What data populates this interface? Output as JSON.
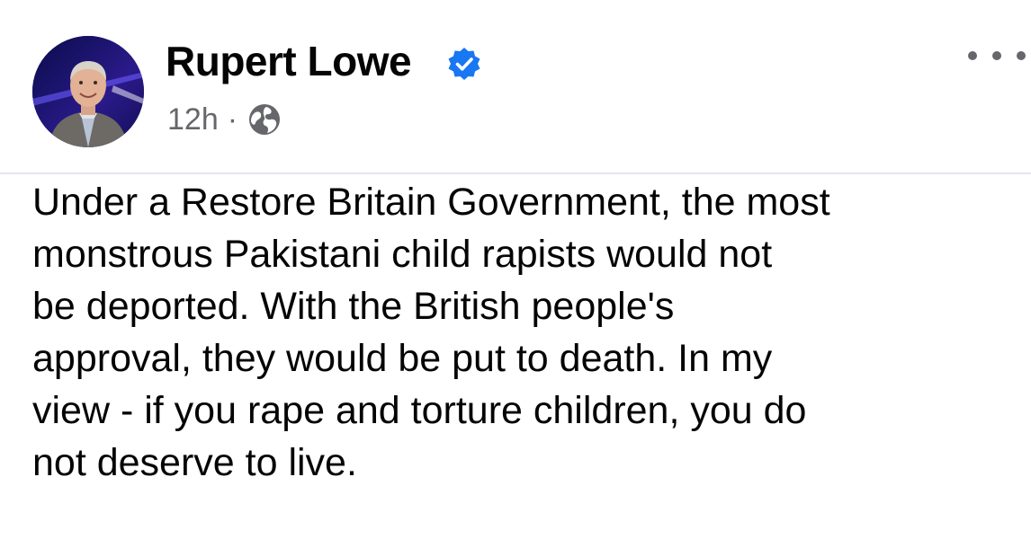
{
  "post": {
    "author": "Rupert Lowe",
    "timestamp": "12h",
    "separator": "·",
    "privacy_icon": "globe-icon",
    "verified_icon": "verified-badge-icon",
    "more_icon": "more-options-icon",
    "body_lines": [
      "Under a Restore Britain Government, the most",
      "monstrous Pakistani child rapists would not",
      "be deported. With the British people's",
      "approval, they would be put to death. In my",
      "view - if you rape and torture children, you do",
      "not deserve to live."
    ]
  },
  "colors": {
    "verified": "#1877f2",
    "meta_text": "#65676b",
    "body_text": "#050505"
  }
}
